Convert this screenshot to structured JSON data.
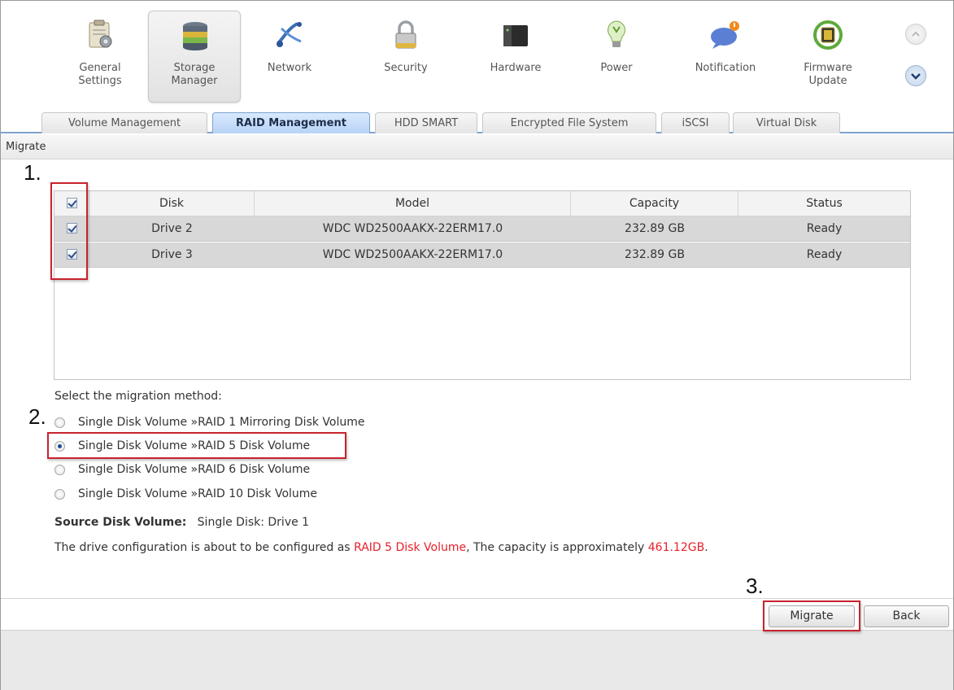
{
  "categories": [
    {
      "label": "General\nSettings",
      "icon": "general-settings-icon",
      "active": false
    },
    {
      "label": "Storage\nManager",
      "icon": "storage-manager-icon",
      "active": true
    },
    {
      "label": "Network",
      "icon": "network-icon",
      "active": false
    },
    {
      "label": "Security",
      "icon": "security-lock-icon",
      "active": false
    },
    {
      "label": "Hardware",
      "icon": "hardware-icon",
      "active": false
    },
    {
      "label": "Power",
      "icon": "power-bulb-icon",
      "active": false
    },
    {
      "label": "Notification",
      "icon": "notification-icon",
      "active": false
    },
    {
      "label": "Firmware\nUpdate",
      "icon": "firmware-update-icon",
      "active": false
    }
  ],
  "tabs": [
    {
      "label": "Volume Management",
      "active": false
    },
    {
      "label": "RAID Management",
      "active": true
    },
    {
      "label": "HDD SMART",
      "active": false
    },
    {
      "label": "Encrypted File System",
      "active": false
    },
    {
      "label": "iSCSI",
      "active": false
    },
    {
      "label": "Virtual Disk",
      "active": false
    }
  ],
  "section_title": "Migrate",
  "table": {
    "headers": [
      "Disk",
      "Model",
      "Capacity",
      "Status"
    ],
    "header_checked": true,
    "rows": [
      {
        "checked": true,
        "disk": "Drive 2",
        "model": "WDC WD2500AAKX-22ERM17.0",
        "capacity": "232.89 GB",
        "status": "Ready"
      },
      {
        "checked": true,
        "disk": "Drive 3",
        "model": "WDC WD2500AAKX-22ERM17.0",
        "capacity": "232.89 GB",
        "status": "Ready"
      }
    ]
  },
  "migration": {
    "prompt": "Select the migration method:",
    "options": [
      {
        "label": "Single Disk Volume »RAID 1 Mirroring Disk Volume",
        "selected": false
      },
      {
        "label": "Single Disk Volume »RAID 5 Disk Volume",
        "selected": true
      },
      {
        "label": "Single Disk Volume »RAID 6 Disk Volume",
        "selected": false
      },
      {
        "label": "Single Disk Volume »RAID 10 Disk Volume",
        "selected": false
      }
    ]
  },
  "source": {
    "label": "Source Disk Volume:",
    "value": "Single Disk: Drive 1"
  },
  "summary": {
    "prefix": "The drive configuration is about to be configured as ",
    "raid_type": "RAID 5 Disk Volume",
    "middle": ", The capacity is approximately ",
    "capacity": "461.12GB",
    "suffix": "."
  },
  "buttons": {
    "migrate": "Migrate",
    "back": "Back"
  },
  "annotations": [
    "1.",
    "2.",
    "3."
  ],
  "colors": {
    "accent": "#7da2ce",
    "highlight_red": "#e8202a",
    "annotation_border": "#c8232c"
  }
}
